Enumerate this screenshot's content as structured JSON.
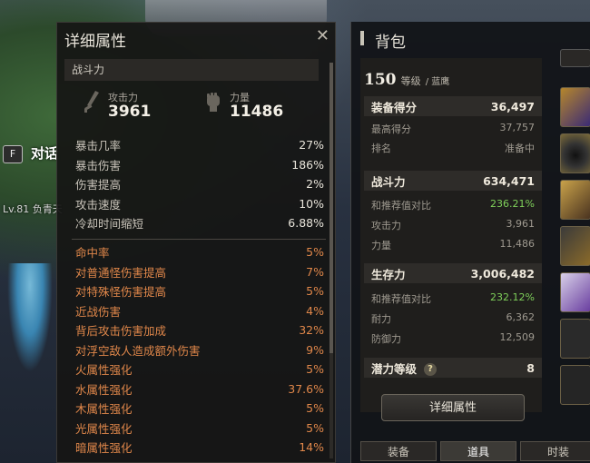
{
  "background": {
    "npc_key": "F",
    "npc_label": "对话",
    "player_level": "Lv.81",
    "player_name": "负青天"
  },
  "detail_panel": {
    "title": "详细属性",
    "section": "战斗力",
    "attack": {
      "label": "攻击力",
      "value": "3961"
    },
    "strength": {
      "label": "力量",
      "value": "11486"
    },
    "stats": [
      {
        "label": "暴击几率",
        "value": "27%"
      },
      {
        "label": "暴击伤害",
        "value": "186%"
      },
      {
        "label": "伤害提高",
        "value": "2%"
      },
      {
        "label": "攻击速度",
        "value": "10%"
      },
      {
        "label": "冷却时间缩短",
        "value": "6.88%"
      }
    ],
    "bonus_stats": [
      {
        "label": "命中率",
        "value": "5%"
      },
      {
        "label": "对普通怪伤害提高",
        "value": "7%"
      },
      {
        "label": "对特殊怪伤害提高",
        "value": "5%"
      },
      {
        "label": "近战伤害",
        "value": "4%"
      },
      {
        "label": "背后攻击伤害加成",
        "value": "32%"
      },
      {
        "label": "对浮空敌人造成额外伤害",
        "value": "9%"
      },
      {
        "label": "火属性强化",
        "value": "5%"
      },
      {
        "label": "水属性强化",
        "value": "37.6%"
      },
      {
        "label": "木属性强化",
        "value": "5%"
      },
      {
        "label": "光属性强化",
        "value": "5%"
      },
      {
        "label": "暗属性强化",
        "value": "14%"
      }
    ]
  },
  "bag_panel": {
    "title": "背包",
    "level": "150",
    "level_unit": "等级",
    "class_name": "/ 蓝鹰",
    "equip_score": {
      "label": "装备得分",
      "value": "36,497"
    },
    "highest_score": {
      "label": "最高得分",
      "value": "37,757"
    },
    "rank": {
      "label": "排名",
      "value": "准备中"
    },
    "combat": {
      "label": "战斗力",
      "value": "634,471"
    },
    "combat_compare": {
      "label": "和推荐值对比",
      "value": "236.21%"
    },
    "combat_attack": {
      "label": "攻击力",
      "value": "3,961"
    },
    "combat_strength": {
      "label": "力量",
      "value": "11,486"
    },
    "survival": {
      "label": "生存力",
      "value": "3,006,482"
    },
    "survival_compare": {
      "label": "和推荐值对比",
      "value": "232.12%"
    },
    "stamina": {
      "label": "耐力",
      "value": "6,362"
    },
    "defense": {
      "label": "防御力",
      "value": "12,509"
    },
    "potential": {
      "label": "潜力等级",
      "help": "?",
      "value": "8"
    },
    "detail_button": "详细属性",
    "tabs": [
      "装备",
      "道具",
      "时装"
    ]
  },
  "colors": {
    "accent_orange": "#e0874a",
    "accent_green": "#7fd05a"
  }
}
